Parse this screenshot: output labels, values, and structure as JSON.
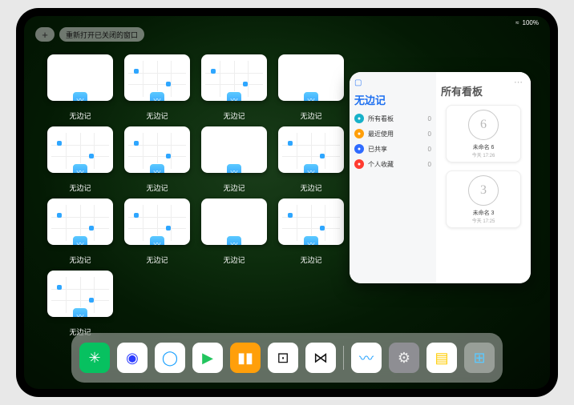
{
  "status": {
    "wifi": "≈",
    "battery": "100%"
  },
  "topbar": {
    "plus": "+",
    "reopen_label": "重新打开已关闭的窗口"
  },
  "app_label": "无边记",
  "windows": [
    {
      "variant": "blank"
    },
    {
      "variant": "calendar"
    },
    {
      "variant": "calendar"
    },
    {
      "variant": "blank"
    },
    {
      "variant": "calendar"
    },
    {
      "variant": "calendar"
    },
    {
      "variant": "blank"
    },
    {
      "variant": "calendar"
    },
    {
      "variant": "calendar"
    },
    {
      "variant": "calendar"
    },
    {
      "variant": "blank"
    },
    {
      "variant": "calendar"
    },
    {
      "variant": "calendar"
    }
  ],
  "panel": {
    "left_title": "无边记",
    "right_title": "所有看板",
    "items": [
      {
        "icon_color": "#17b1c9",
        "icon_name": "cloud-icon",
        "label": "所有看板",
        "count": "0"
      },
      {
        "icon_color": "#ff9f0a",
        "icon_name": "clock-icon",
        "label": "最近使用",
        "count": "0"
      },
      {
        "icon_color": "#2f6bff",
        "icon_name": "shared-icon",
        "label": "已共享",
        "count": "0"
      },
      {
        "icon_color": "#ff3b30",
        "icon_name": "heart-icon",
        "label": "个人收藏",
        "count": "0"
      }
    ],
    "boards": [
      {
        "doodle": "6",
        "name": "未命名 6",
        "time": "今天 17:26"
      },
      {
        "doodle": "3",
        "name": "未命名 3",
        "time": "今天 17:25"
      }
    ]
  },
  "dock": [
    {
      "name": "wechat-icon",
      "bg": "#07c160",
      "glyph": "✳",
      "fg": "#fff"
    },
    {
      "name": "quark-icon",
      "bg": "#fff",
      "glyph": "◉",
      "fg": "#2b3bff"
    },
    {
      "name": "browser-icon",
      "bg": "#fff",
      "glyph": "◯",
      "fg": "#18a0ff"
    },
    {
      "name": "play-icon",
      "bg": "#fff",
      "glyph": "▶",
      "fg": "#22c55e"
    },
    {
      "name": "books-icon",
      "bg": "#ff9f0a",
      "glyph": "▮▮",
      "fg": "#fff"
    },
    {
      "name": "dice-icon",
      "bg": "#fff",
      "glyph": "⊡",
      "fg": "#111"
    },
    {
      "name": "connect-icon",
      "bg": "#fff",
      "glyph": "⋈",
      "fg": "#111"
    },
    {
      "name": "freeform-icon",
      "bg": "#fff",
      "glyph": "〰",
      "fg": "#2ea6ff"
    },
    {
      "name": "settings-icon",
      "bg": "#8e8e93",
      "glyph": "⚙",
      "fg": "#eee"
    },
    {
      "name": "notes-icon",
      "bg": "#fff",
      "glyph": "▤",
      "fg": "#ffcc00"
    },
    {
      "name": "apps-folder-icon",
      "bg": "rgba(255,255,255,0.35)",
      "glyph": "⊞",
      "fg": "#5bc9ff"
    }
  ]
}
